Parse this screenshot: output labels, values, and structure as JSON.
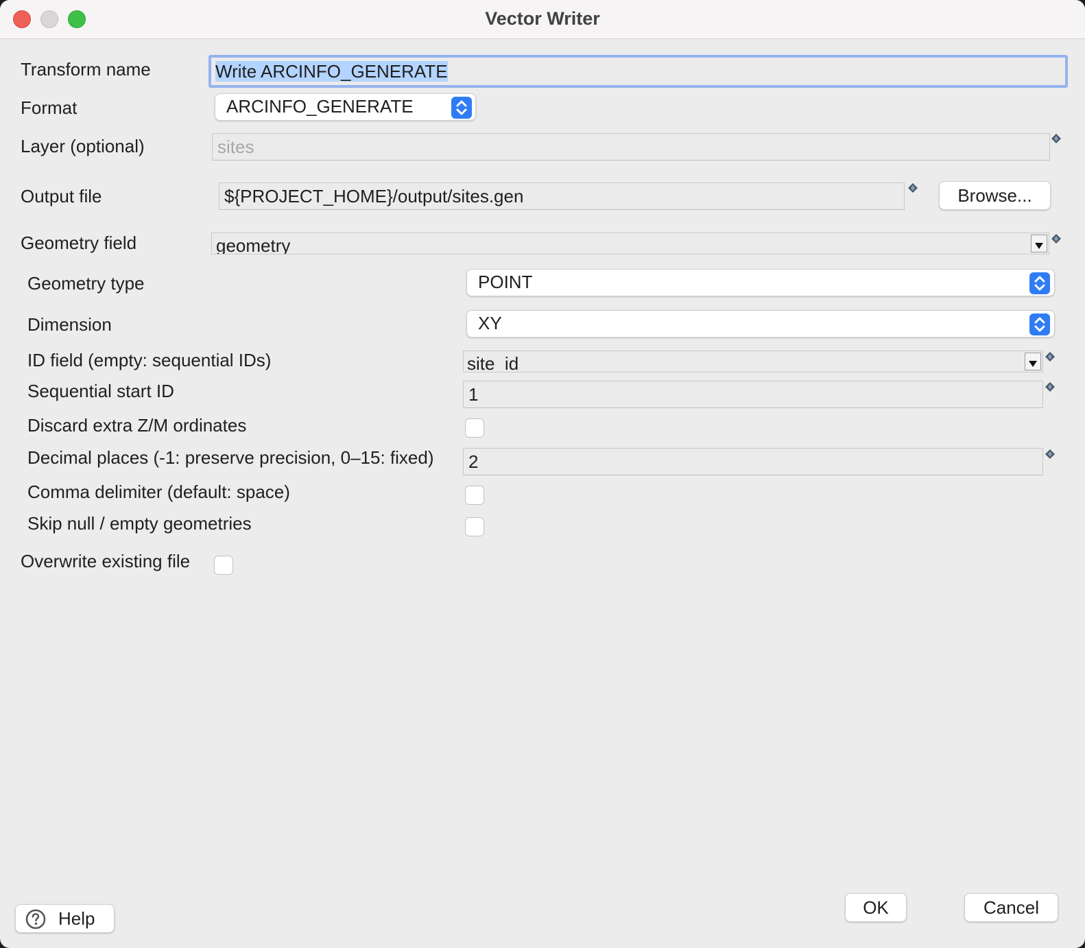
{
  "window": {
    "title": "Vector Writer"
  },
  "form": {
    "transform_name": {
      "label": "Transform name",
      "value": "Write ARCINFO_GENERATE"
    },
    "format": {
      "label": "Format",
      "value": "ARCINFO_GENERATE"
    },
    "layer": {
      "label": "Layer (optional)",
      "placeholder": "sites"
    },
    "output_file": {
      "label": "Output file",
      "value": "${PROJECT_HOME}/output/sites.gen",
      "browse_label": "Browse..."
    },
    "geometry_field": {
      "label": "Geometry field",
      "value": "geometry"
    },
    "overwrite": {
      "label": "Overwrite existing file",
      "checked": false
    }
  },
  "options": {
    "geometry_type": {
      "label": "Geometry type",
      "value": "POINT"
    },
    "dimension": {
      "label": "Dimension",
      "value": "XY"
    },
    "id_field": {
      "label": "ID field (empty: sequential IDs)",
      "value": "site_id"
    },
    "start_id": {
      "label": "Sequential start ID",
      "value": "1"
    },
    "discard_zm": {
      "label": "Discard extra Z/M ordinates",
      "checked": false
    },
    "decimal_places": {
      "label": "Decimal places (-1: preserve precision, 0–15: fixed)",
      "value": "2"
    },
    "comma_delimiter": {
      "label": "Comma delimiter (default: space)",
      "checked": false
    },
    "skip_null": {
      "label": "Skip null / empty geometries",
      "checked": false
    }
  },
  "footer": {
    "help_label": "Help",
    "ok_label": "OK",
    "cancel_label": "Cancel"
  },
  "colors": {
    "accent": "#2f7cf6",
    "focus_ring": "#94b3ef",
    "selection": "#b3d4ff"
  }
}
